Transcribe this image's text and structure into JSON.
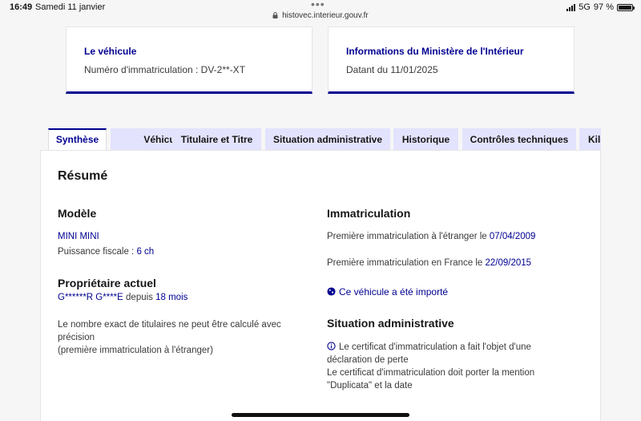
{
  "status_bar": {
    "time": "16:49",
    "date": "Samedi 11 janvier",
    "url": "histovec.interieur.gouv.fr",
    "network": "5G",
    "battery": "97 %",
    "battery_level": 0.97
  },
  "vehicle_card": {
    "title": "Le véhicule",
    "text": "Numéro d'immatriculation : DV-2**-XT"
  },
  "ministry_card": {
    "title": "Informations du Ministère de l'Intérieur",
    "text": "Datant du 11/01/2025"
  },
  "tabs": [
    {
      "label": "Synthèse",
      "active": true
    },
    {
      "label": "Véhicule",
      "active": false
    },
    {
      "label": "Titulaire et Titre",
      "active": false
    },
    {
      "label": "Situation administrative",
      "active": false
    },
    {
      "label": "Historique",
      "active": false
    },
    {
      "label": "Contrôles techniques",
      "active": false
    },
    {
      "label": "Kilométrage",
      "active": false
    }
  ],
  "summary": {
    "title": "Résumé",
    "model": {
      "heading": "Modèle",
      "name": "MINI MINI",
      "fiscal_label": "Puissance fiscale : ",
      "fiscal_value": "6 ch"
    },
    "owner": {
      "heading": "Propriétaire actuel",
      "name": "G******R G****E",
      "since_label": " depuis ",
      "since_value": "18 mois",
      "note_line1": "Le nombre exact de titulaires ne peut être calculé avec",
      "note_line2": "précision",
      "note_line3": "(première immatriculation à l'étranger)"
    },
    "registration": {
      "heading": "Immatriculation",
      "foreign_label": "Première immatriculation à l'étranger le ",
      "foreign_date": "07/04/2009",
      "france_label": "Première immatriculation en France le ",
      "france_date": "22/09/2015",
      "imported": "Ce véhicule a été importé"
    },
    "admin": {
      "heading": "Situation administrative",
      "line1": "Le certificat d'immatriculation a fait l'objet d'une",
      "line2": "déclaration de perte",
      "line3": "Le certificat d'immatriculation doit porter la mention",
      "line4": "\"Duplicata\" et la date"
    }
  }
}
